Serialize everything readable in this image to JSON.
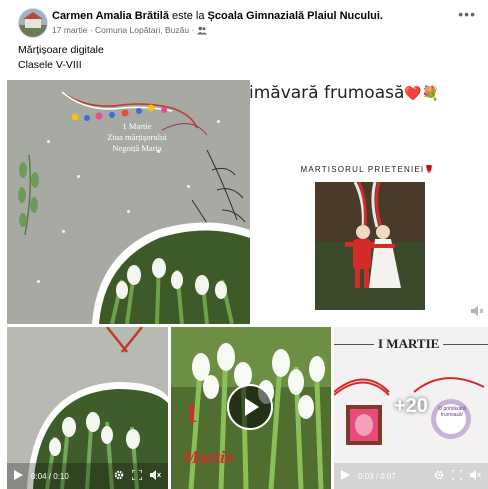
{
  "post": {
    "author": "Carmen Amalia Brătilă",
    "connector": "este la",
    "place": "Școala Gimnazială Plaiul Nucului.",
    "date": "17 martie",
    "location": "Comuna Lopătari, Buzău",
    "more_label": "•••",
    "caption_line1": "Mărțișoare digitale",
    "caption_line2": "Clasele V-VIII"
  },
  "media": {
    "main_tile": {
      "line1": "1 Martie",
      "line2": "Ziua mărțișorului",
      "line3": "Negoiță Maria"
    },
    "right_tile": {
      "banner": "rimăvară frumoasă",
      "banner_emoji": "❤️💐",
      "subtitle": "MARTISORUL PRIETENIEI",
      "subtitle_emoji": "🌹"
    },
    "bottom1": {
      "time": "0:04 / 0:10"
    },
    "bottom2": {
      "big_number": "1",
      "word": "Martie"
    },
    "bottom3": {
      "header": "I MARTIE",
      "more_count": "+20",
      "badge_text": "O primăvară frumoasă!",
      "time": "0:03 / 0:07"
    }
  },
  "colors": {
    "text_primary": "#050505",
    "text_secondary": "#65676b",
    "martisor_red": "#d42a2a"
  }
}
